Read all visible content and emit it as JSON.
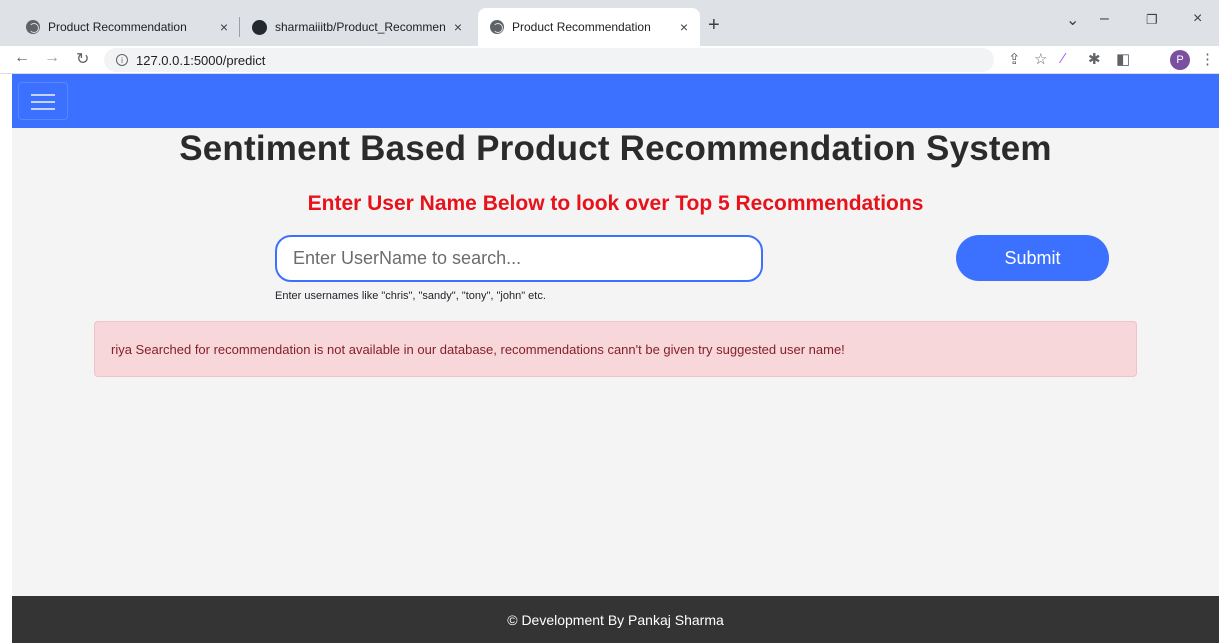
{
  "browser": {
    "tabs": [
      {
        "title": "Product Recommendation",
        "close": "×"
      },
      {
        "title": "sharmaiiitb/Product_Recommenda",
        "close": "×"
      },
      {
        "title": "Product Recommendation",
        "close": "×"
      }
    ],
    "new_tab": "+",
    "url": "127.0.0.1:5000/predict",
    "profile_initial": "P",
    "window_controls": {
      "chevron": "⌄",
      "minimize": "–",
      "restore": "❐",
      "close": "×"
    }
  },
  "page": {
    "title": "Sentiment Based Product Recommendation System",
    "subtitle": "Enter User Name Below to look over Top 5 Recommendations",
    "search": {
      "placeholder": "Enter UserName to search...",
      "value": ""
    },
    "submit_label": "Submit",
    "hint": "Enter usernames like \"chris\", \"sandy\", \"tony\", \"john\" etc.",
    "alert": "riya Searched for recommendation is not available in our database, recommendations cann't be given try suggested user name!",
    "footer": "© Development By Pankaj Sharma"
  },
  "colors": {
    "navbar": "#3b71fe",
    "subtitle": "#e8121a",
    "alert_bg": "#f8d7da",
    "alert_text": "#842029",
    "footer_bg": "#343434"
  }
}
